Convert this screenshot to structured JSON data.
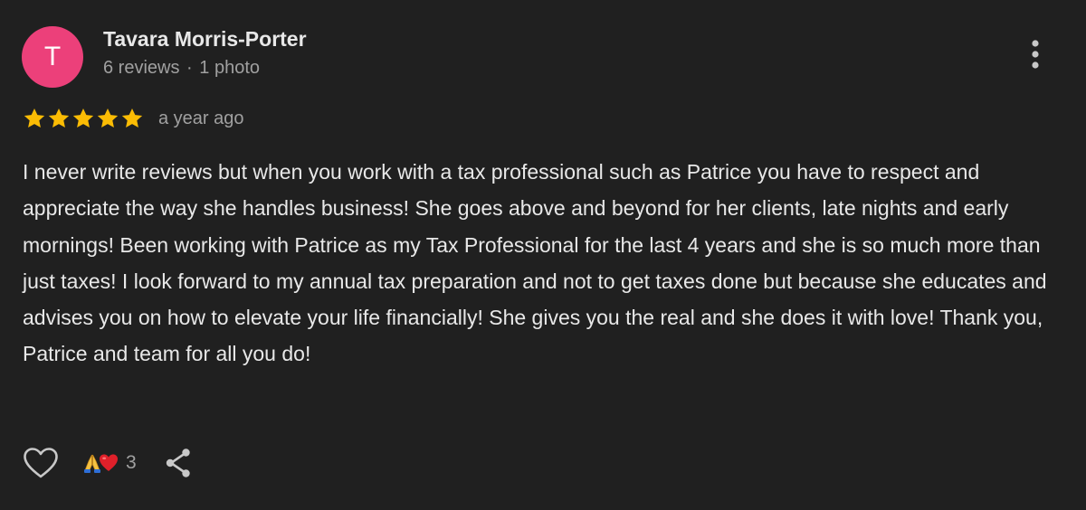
{
  "review": {
    "author": {
      "initial": "T",
      "name": "Tavara Morris-Porter",
      "review_count": "6 reviews",
      "separator": "·",
      "photo_count": "1 photo",
      "avatar_color": "#ec407a"
    },
    "rating": 5,
    "rating_max": 5,
    "star_color": "#fbbc04",
    "time_ago": "a year ago",
    "text": "I never write reviews but when you work with a tax professional such as Patrice you have to respect and appreciate the way she handles business! She goes above and beyond for her clients, late nights and early mornings! Been working with Patrice as my Tax Professional for the last 4 years and she is so much more than just taxes! I look forward to my annual tax preparation and not to get taxes done but because she educates and advises you on how to elevate your life financially! She gives you the real and she does it with love! Thank you, Patrice and team for all you do!",
    "reactions": {
      "icons": [
        "folded-hands-icon",
        "red-heart-icon"
      ],
      "count": "3"
    },
    "actions": {
      "like_icon": "heart-outline-icon",
      "share_icon": "share-icon",
      "more_icon": "more-vert-icon"
    }
  }
}
